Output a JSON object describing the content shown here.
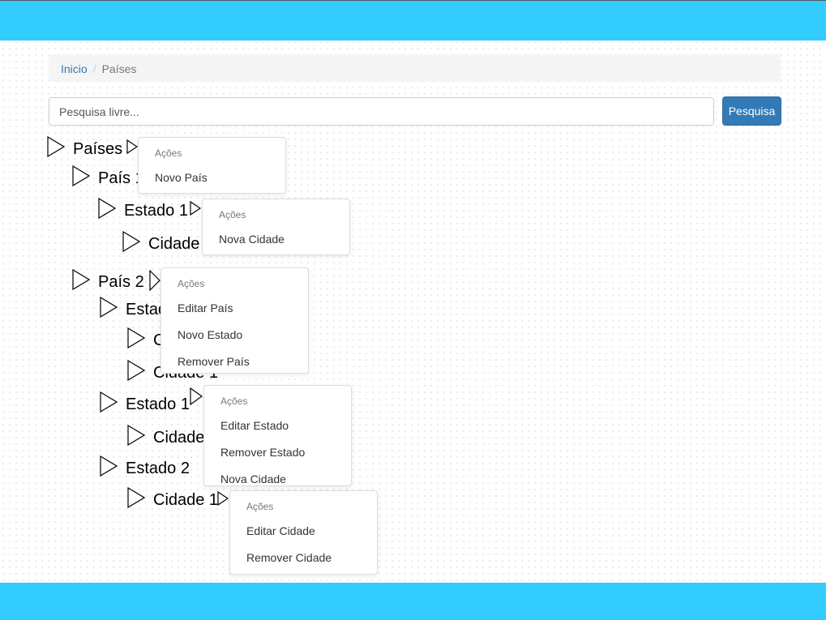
{
  "breadcrumb": {
    "home": "Inicio",
    "current": "Países"
  },
  "search": {
    "placeholder": "Pesquisa livre...",
    "button": "Pesquisa"
  },
  "tree": [
    "Países",
    "País 1",
    "Estado 1",
    "Cidade 1",
    "País 2",
    "Estado 1",
    "Cidade 1",
    "Cidade 1",
    "Estado 1",
    "Cidade 1",
    "Estado 2",
    "Cidade 1"
  ],
  "menus": [
    {
      "header": "Ações",
      "items": [
        "Novo País"
      ]
    },
    {
      "header": "Ações",
      "items": [
        "Nova Cidade"
      ]
    },
    {
      "header": "Ações",
      "items": [
        "Editar País",
        "Novo Estado",
        "Remover País"
      ]
    },
    {
      "header": "Ações",
      "items": [
        "Editar Estado",
        "Remover Estado",
        "Nova Cidade"
      ]
    },
    {
      "header": "Ações",
      "items": [
        "Editar Cidade",
        "Remover Cidade"
      ]
    }
  ]
}
